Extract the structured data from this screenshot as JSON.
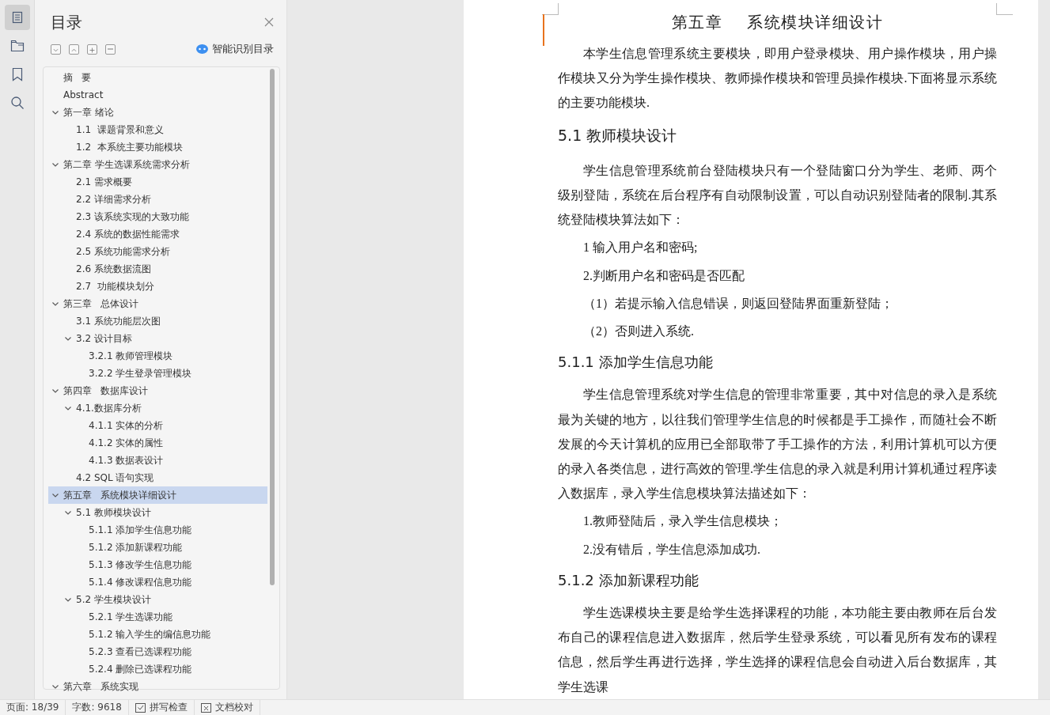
{
  "rail": {
    "items": [
      {
        "kind": "toc",
        "selected": true
      },
      {
        "kind": "outline",
        "selected": false
      },
      {
        "kind": "bookmark",
        "selected": false
      },
      {
        "kind": "search",
        "selected": false
      }
    ]
  },
  "toc_panel": {
    "title": "目录",
    "smart_button": "智能识别目录",
    "items": [
      {
        "label": "摘   要",
        "selected": false
      },
      {
        "label": "Abstract",
        "selected": false
      },
      {
        "label": "第一章 绪论",
        "selected": false,
        "expanded": true,
        "children": [
          {
            "label": "1.1  课题背景和意义",
            "selected": false
          },
          {
            "label": "1.2  本系统主要功能模块",
            "selected": false
          }
        ]
      },
      {
        "label": "第二章 学生选课系统需求分析",
        "selected": false,
        "expanded": true,
        "children": [
          {
            "label": "2.1 需求概要",
            "selected": false
          },
          {
            "label": "2.2 详细需求分析",
            "selected": false
          },
          {
            "label": "2.3 该系统实现的大致功能",
            "selected": false
          },
          {
            "label": "2.4 系统的数据性能需求",
            "selected": false
          },
          {
            "label": "2.5 系统功能需求分析",
            "selected": false
          },
          {
            "label": "2.6 系统数据流图",
            "selected": false
          },
          {
            "label": "2.7  功能模块划分",
            "selected": false
          }
        ]
      },
      {
        "label": "第三章   总体设计",
        "selected": false,
        "expanded": true,
        "children": [
          {
            "label": "3.1 系统功能层次图",
            "selected": false
          },
          {
            "label": "3.2 设计目标",
            "selected": false,
            "expanded": true,
            "children": [
              {
                "label": "3.2.1 教师管理模块",
                "selected": false
              },
              {
                "label": "3.2.2 学生登录管理模块",
                "selected": false
              }
            ]
          }
        ]
      },
      {
        "label": "第四章   数据库设计",
        "selected": false,
        "expanded": true,
        "children": [
          {
            "label": "4.1.数据库分析",
            "selected": false,
            "expanded": true,
            "children": [
              {
                "label": "4.1.1 实体的分析",
                "selected": false
              },
              {
                "label": "4.1.2 实体的属性",
                "selected": false
              },
              {
                "label": "4.1.3 数据表设计",
                "selected": false
              }
            ]
          },
          {
            "label": "4.2 SQL 语句实现",
            "selected": false
          }
        ]
      },
      {
        "label": "第五章   系统模块详细设计",
        "selected": true,
        "expanded": true,
        "children": [
          {
            "label": "5.1 教师模块设计",
            "selected": false,
            "expanded": true,
            "children": [
              {
                "label": "5.1.1 添加学生信息功能",
                "selected": false
              },
              {
                "label": "5.1.2 添加新课程功能",
                "selected": false
              },
              {
                "label": "5.1.3 修改学生信息功能",
                "selected": false
              },
              {
                "label": "5.1.4 修改课程信息功能",
                "selected": false
              }
            ]
          },
          {
            "label": "5.2 学生模块设计",
            "selected": false,
            "expanded": true,
            "children": [
              {
                "label": "5.2.1 学生选课功能",
                "selected": false
              },
              {
                "label": "5.1.2 输入学生的编信息功能",
                "selected": false
              },
              {
                "label": "5.2.3 查看已选课程功能",
                "selected": false
              },
              {
                "label": "5.2.4 删除已选课程功能",
                "selected": false
              }
            ]
          }
        ]
      },
      {
        "label": "第六章   系统实现",
        "selected": false,
        "expanded": true
      }
    ]
  },
  "document": {
    "title": "第五章    系统模块详细设计",
    "blocks": [
      {
        "kind": "body",
        "text": "本学生信息管理系统主要模块，即用户登录模块、用户操作模块，用户操作模块又分为学生操作模块、教师操作模块和管理员操作模块.下面将显示系统的主要功能模块."
      },
      {
        "kind": "heading2",
        "text": "5.1 教师模块设计"
      },
      {
        "kind": "body",
        "text": "学生信息管理系统前台登陆模块只有一个登陆窗口分为学生、老师、两个级别登陆，系统在后台程序有自动限制设置，可以自动识别登陆者的限制.其系统登陆模块算法如下："
      },
      {
        "kind": "list",
        "text": "1  输入用户名和密码;"
      },
      {
        "kind": "list",
        "text": "2.判断用户名和密码是否匹配"
      },
      {
        "kind": "list",
        "text": "（1）若提示输入信息错误，则返回登陆界面重新登陆；"
      },
      {
        "kind": "list",
        "text": "（2）否则进入系统."
      },
      {
        "kind": "heading3",
        "text": "5.1.1 添加学生信息功能"
      },
      {
        "kind": "body",
        "text": "学生信息管理系统对学生信息的管理非常重要，其中对信息的录入是系统最为关键的地方，以往我们管理学生信息的时候都是手工操作，而随社会不断发展的今天计算机的应用已全部取带了手工操作的方法，利用计算机可以方便的录入各类信息，进行高效的管理.学生信息的录入就是利用计算机通过程序读入数据库，录入学生信息模块算法描述如下："
      },
      {
        "kind": "list",
        "text": "1.教师登陆后，录入学生信息模块；"
      },
      {
        "kind": "list",
        "text": "2.没有错后，学生信息添加成功."
      },
      {
        "kind": "heading3",
        "text": "5.1.2 添加新课程功能"
      },
      {
        "kind": "body",
        "text": "学生选课模块主要是给学生选择课程的功能，本功能主要由教师在后台发布自己的课程信息进入数据库，然后学生登录系统，可以看见所有发布的课程信息，然后学生再进行选择，学生选择的课程信息会自动进入后台数据库，其学生选课"
      }
    ]
  },
  "status_bar": {
    "page": "页面: 18/39",
    "words": "字数: 9618",
    "spell_check": "拼写检查",
    "proofread": "文档校对"
  }
}
